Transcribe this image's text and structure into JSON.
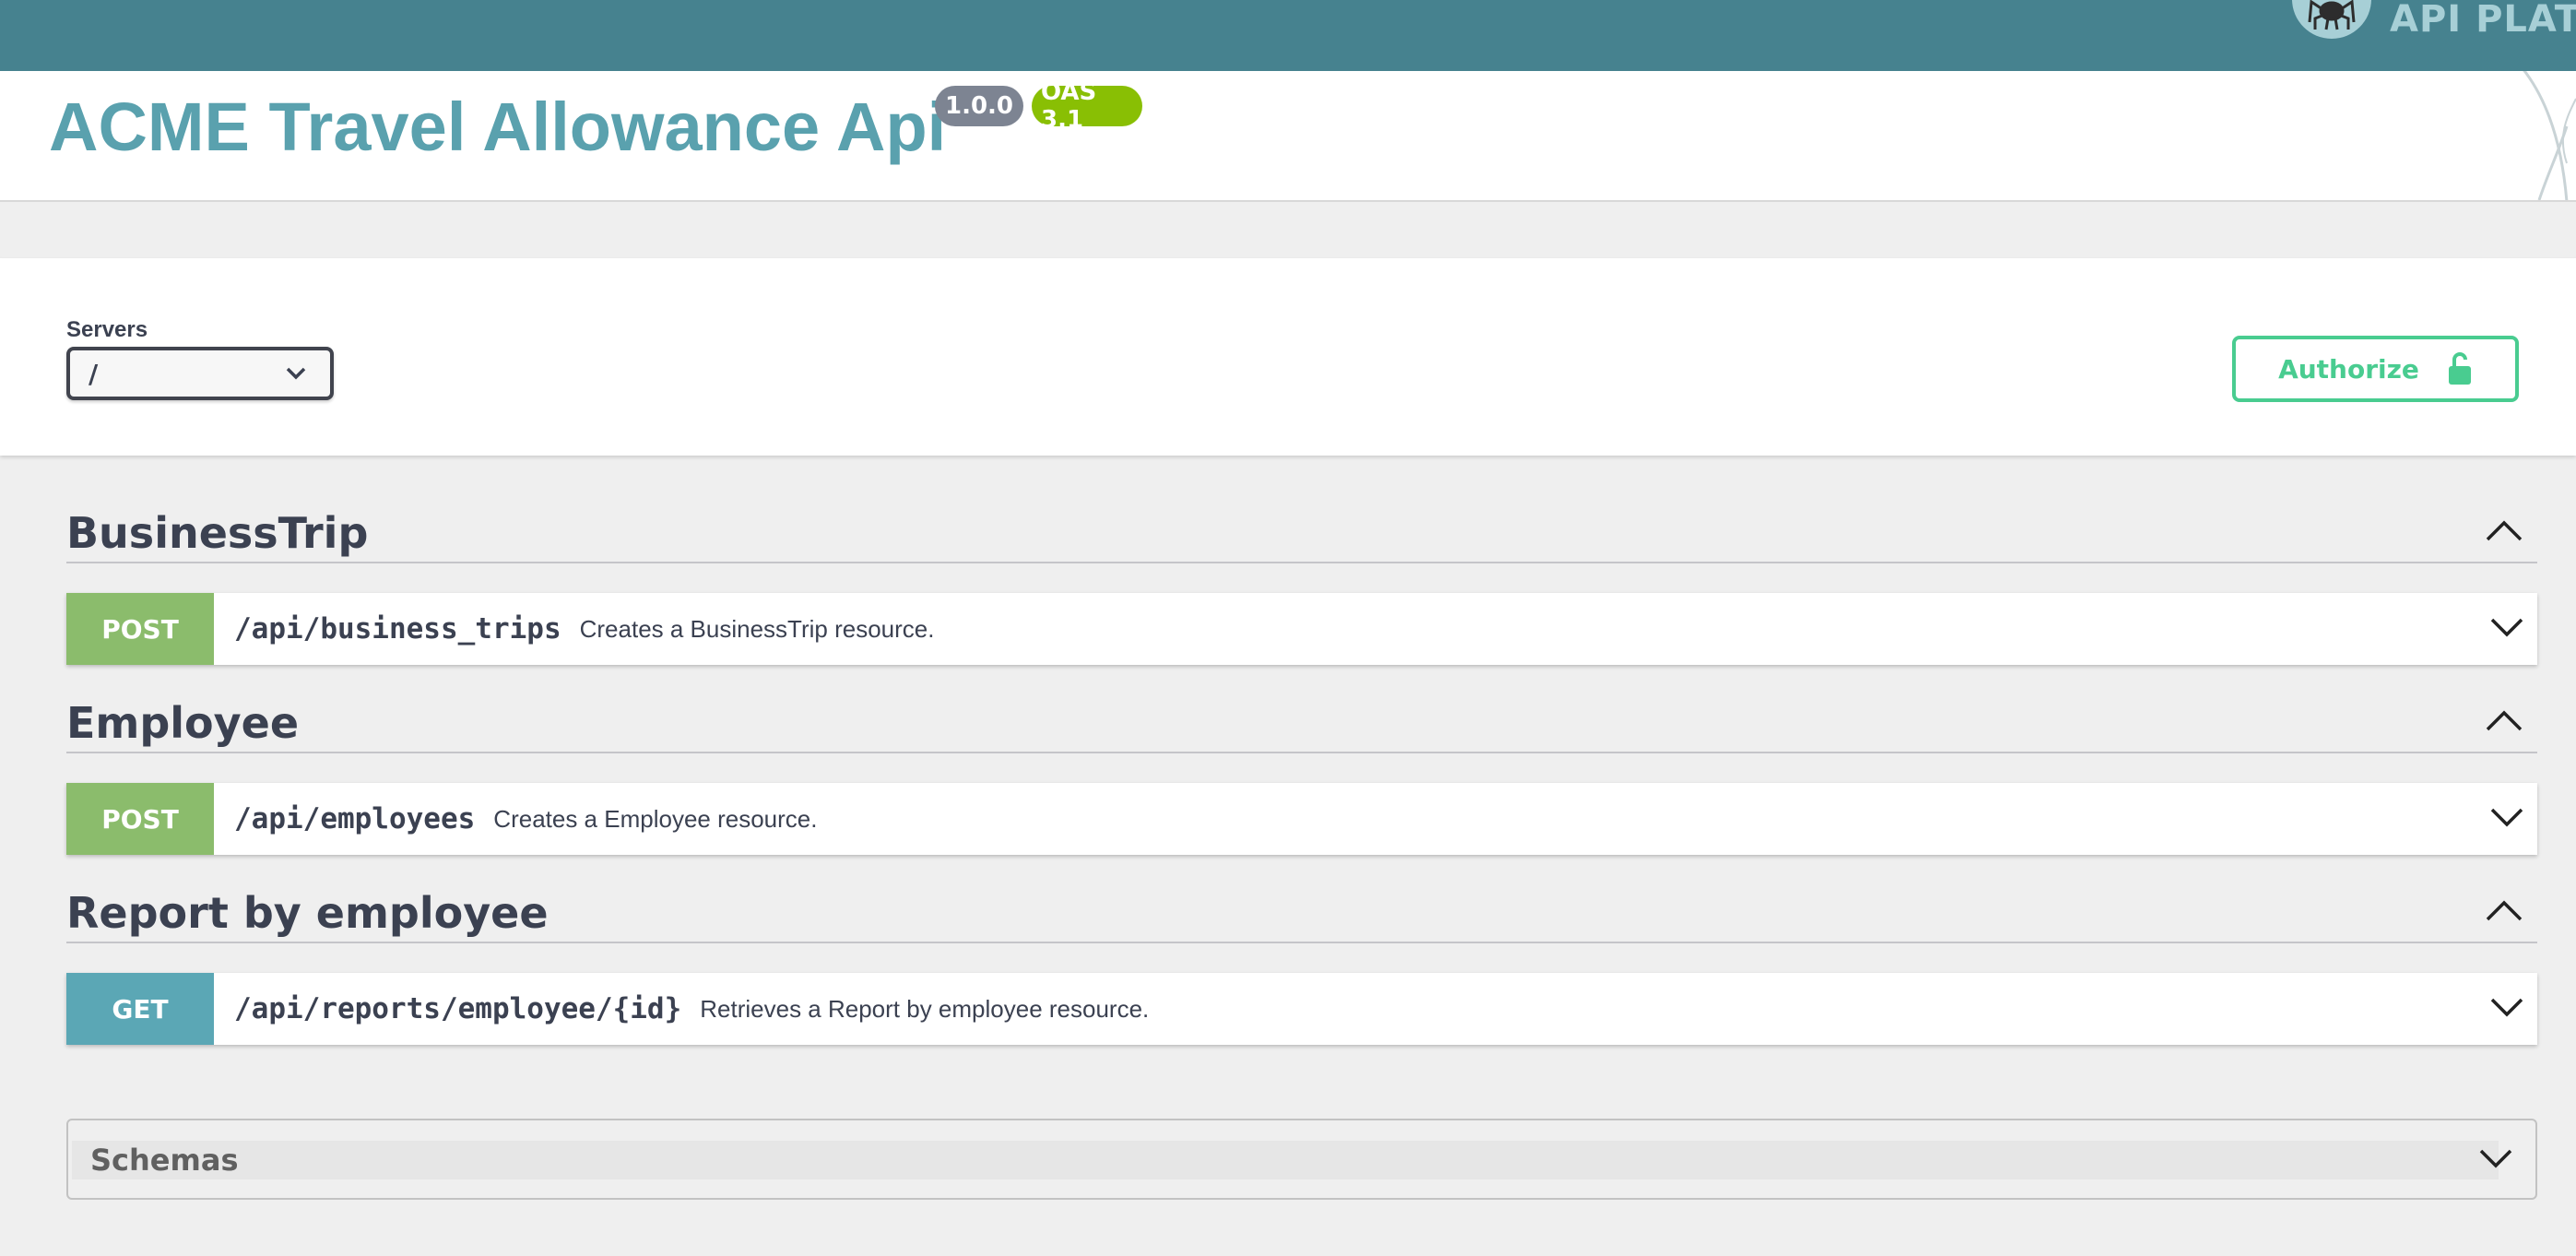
{
  "brand": {
    "name": "API PLATFORM"
  },
  "info": {
    "title": "ACME Travel Allowance Api",
    "version": "1.0.0",
    "oas": "OAS 3.1"
  },
  "servers": {
    "label": "Servers",
    "selected": "/"
  },
  "authorize": {
    "label": "Authorize"
  },
  "tags": [
    {
      "name": "BusinessTrip",
      "operation": {
        "method": "POST",
        "path": "/api/business_trips",
        "summary": "Creates a BusinessTrip resource."
      }
    },
    {
      "name": "Employee",
      "operation": {
        "method": "POST",
        "path": "/api/employees",
        "summary": "Creates a Employee resource."
      }
    },
    {
      "name": "Report by employee",
      "operation": {
        "method": "GET",
        "path": "/api/reports/employee/{id}",
        "summary": "Retrieves a Report by employee resource."
      }
    }
  ],
  "schemas": {
    "title": "Schemas"
  },
  "colors": {
    "topbar": "#46828f",
    "title": "#5aa1ae",
    "post": "#8bbc6c",
    "get": "#5ba7b5",
    "authorize": "#49cc90",
    "version_badge": "#7d8492",
    "oas_badge": "#89bf04"
  },
  "icons": {
    "brand": "spider-logo-icon",
    "server_select": "chevron-down-icon",
    "authorize": "lock-open-icon",
    "tag_toggle": "chevron-up-icon",
    "op_toggle": "chevron-down-icon"
  }
}
